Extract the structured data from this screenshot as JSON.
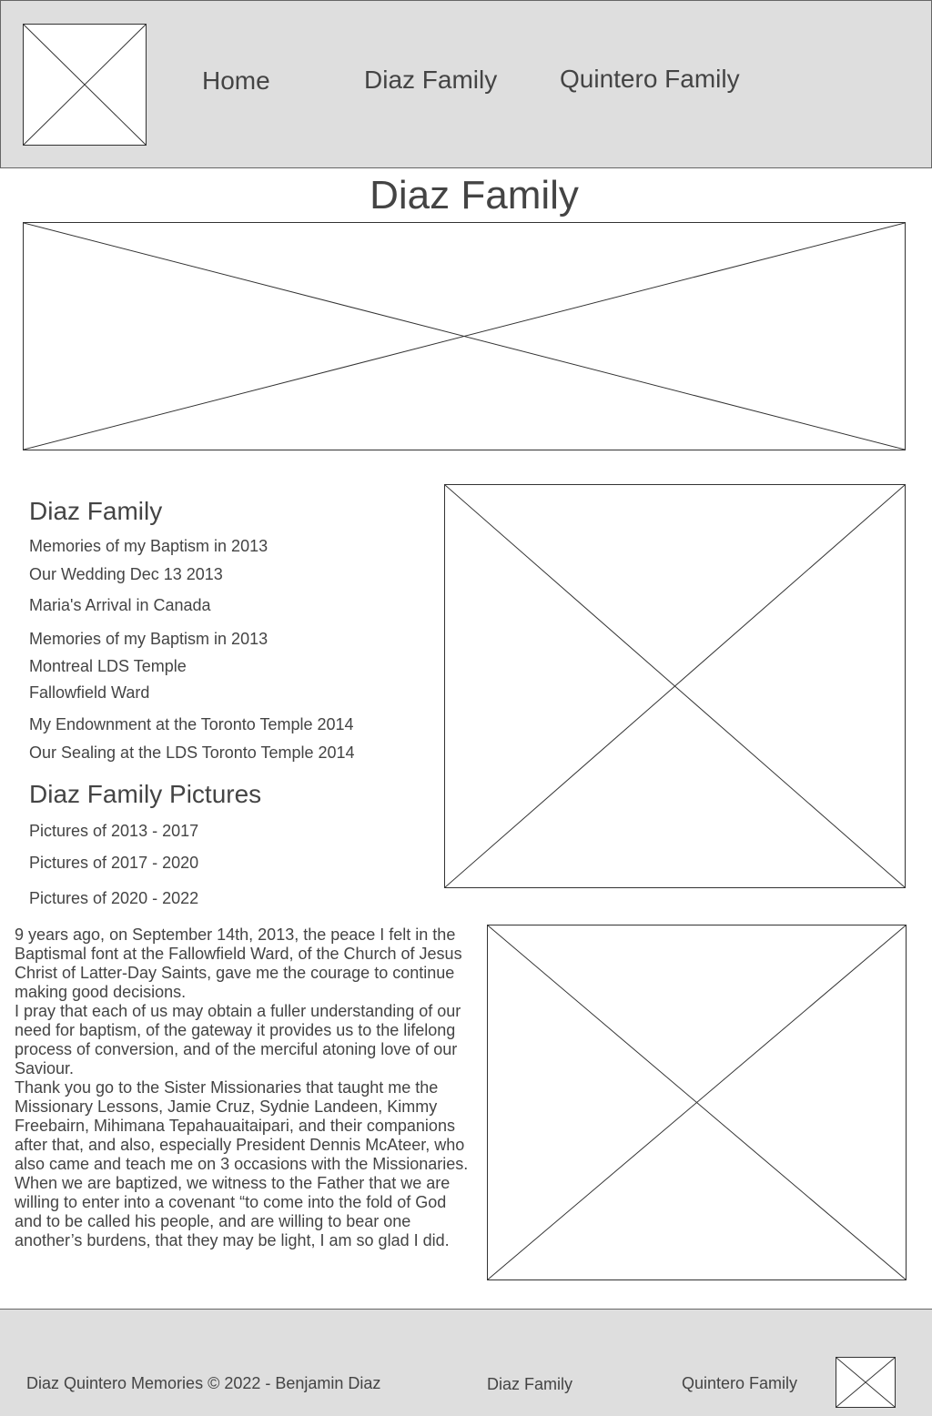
{
  "header": {
    "nav": [
      {
        "label": "Home"
      },
      {
        "label": "Diaz Family"
      },
      {
        "label": "Quintero Family"
      }
    ]
  },
  "page_title": "Diaz Family",
  "memories_section": {
    "heading": "Diaz Family",
    "links": [
      "Memories of my Baptism in 2013",
      "Our Wedding Dec 13 2013",
      "Maria's Arrival in Canada",
      "Memories of my Baptism in 2013",
      "Montreal LDS Temple",
      "Fallowfield Ward",
      "My Endownment at the Toronto Temple 2014",
      "Our Sealing at the LDS Toronto Temple 2014"
    ]
  },
  "pictures_section": {
    "heading": "Diaz Family Pictures",
    "links": [
      "Pictures of 2013 - 2017",
      "Pictures of 2017 - 2020",
      "Pictures of 2020 - 2022"
    ]
  },
  "article": {
    "paragraphs": [
      "9 years ago, on September 14th, 2013, the peace I felt in the Baptismal font at the Fallowfield Ward, of the Church of Jesus Christ of Latter-Day Saints, gave me the courage to continue making good decisions.",
      "I pray that each of us may obtain a fuller understanding of our need for baptism, of the gateway it provides us to the lifelong process of conversion, and of the merciful atoning love of our Saviour.",
      "Thank you go to the Sister Missionaries that taught me the Missionary Lessons, Jamie Cruz, Sydnie Landeen, Kimmy Freebairn, Mihimana Tepahauaitaipari, and their companions after that, and also, especially President Dennis McAteer, who also came and teach me on 3 occasions with the Missionaries.",
      "When we are baptized, we witness to the Father that we are willing to enter into a covenant “to come into the fold of God and to be called his people, and are willing to bear one another’s burdens, that they may be light, I am so glad I did."
    ]
  },
  "footer": {
    "copyright": "Diaz Quintero Memories © 2022 - Benjamin Diaz",
    "links": [
      "Diaz Family",
      "Quintero Family"
    ]
  },
  "colors": {
    "header_bg": "#dedede",
    "footer_bg": "#dedede",
    "text": "#444444",
    "border": "#333333"
  }
}
